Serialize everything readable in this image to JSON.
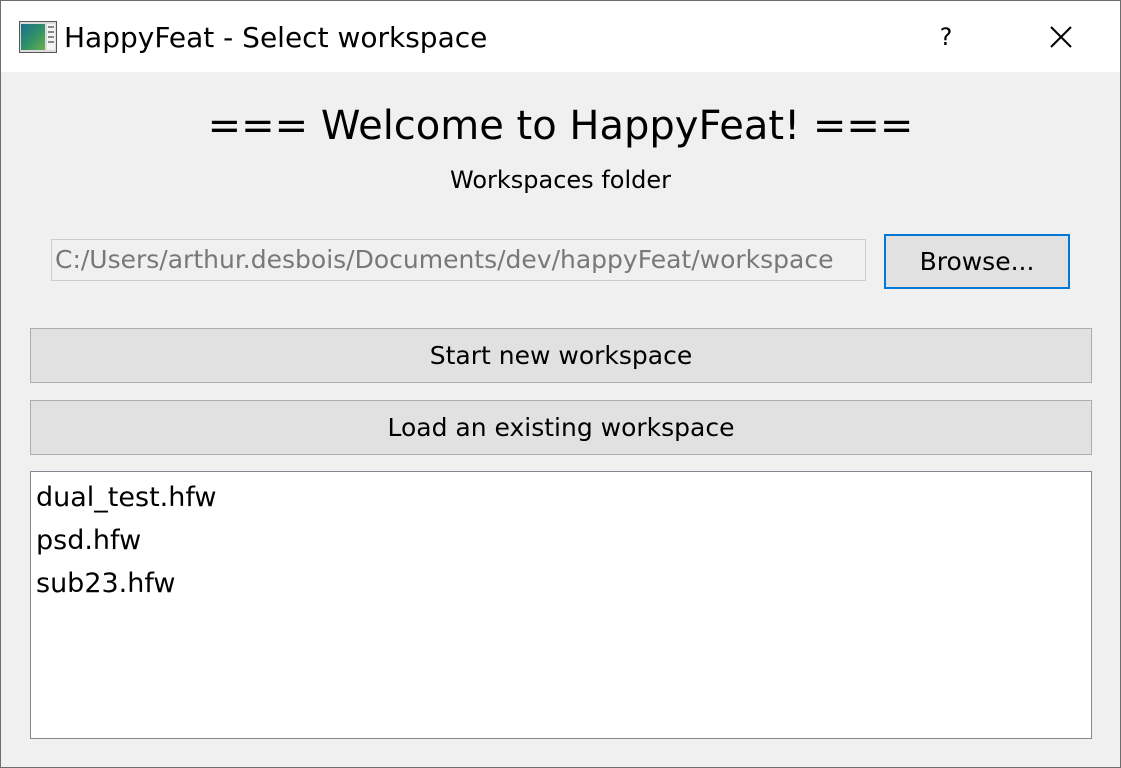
{
  "window": {
    "title": "HappyFeat - Select workspace",
    "help_label": "?",
    "icons": {
      "app": "app-icon",
      "close": "close-icon"
    }
  },
  "main": {
    "heading": "=== Welcome to HappyFeat! ===",
    "folder_label": "Workspaces folder",
    "folder_path": "C:/Users/arthur.desbois/Documents/dev/happyFeat/workspace",
    "browse_label": "Browse...",
    "start_new_label": "Start new workspace",
    "load_existing_label": "Load an existing workspace"
  },
  "workspaces": [
    {
      "name": "dual_test.hfw"
    },
    {
      "name": "psd.hfw"
    },
    {
      "name": "sub23.hfw"
    }
  ],
  "colors": {
    "focus_border": "#0078d7",
    "button_bg": "#e1e1e1",
    "window_bg": "#f0f0f0",
    "disabled_text": "#787878"
  }
}
